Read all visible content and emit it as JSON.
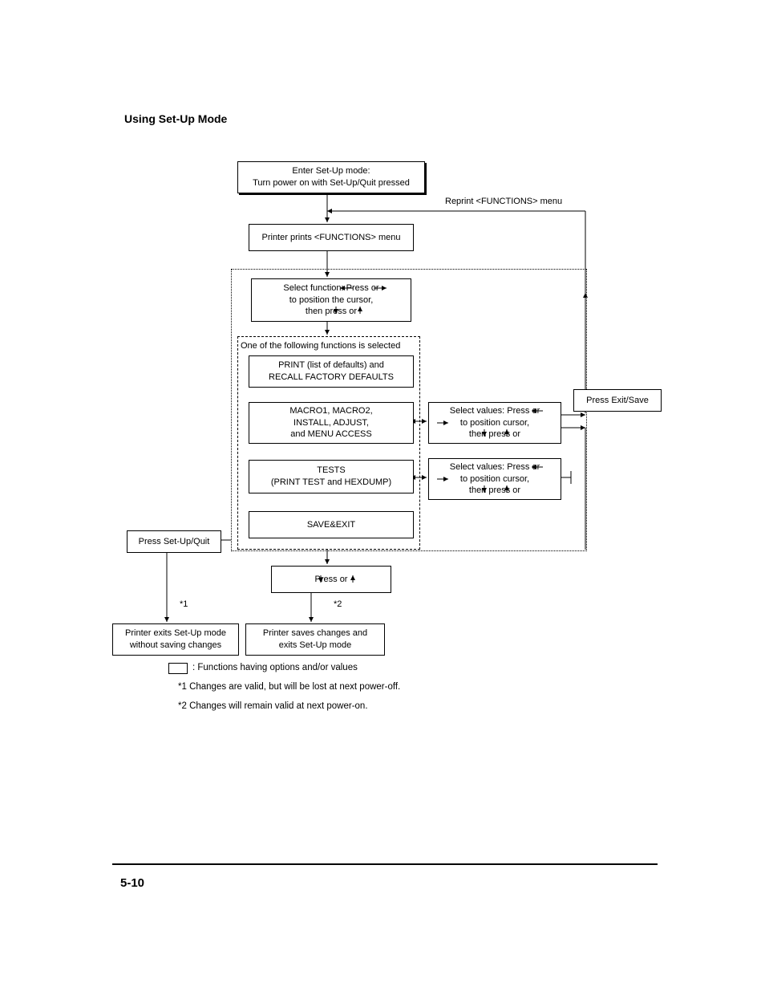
{
  "header": {
    "title": "Using Set-Up Mode"
  },
  "labels": {
    "reprint": "Reprint <FUNCTIONS> menu",
    "exit_save": "Press Exit/Save",
    "setup_quit": "Press Set-Up/Quit",
    "star1": "*1",
    "star2": "*2",
    "one_of": "One of the following functions is selected"
  },
  "boxes": {
    "enter1": "Enter Set-Up mode:",
    "enter2": "Turn power on with Set-Up/Quit pressed",
    "prints": "Printer prints <FUNCTIONS> menu",
    "select1": "Select function:  Press           or",
    "select2": "to position the cursor,",
    "select3": "then press         or",
    "print_defaults1": "PRINT (list of defaults) and",
    "print_defaults2": "RECALL FACTORY DEFAULTS",
    "macro1": "MACRO1, MACRO2,",
    "macro2": "INSTALL, ADJUST,",
    "macro3": "and MENU ACCESS",
    "tests1": "TESTS",
    "tests2": "(PRINT TEST and HEXDUMP)",
    "save_exit": "SAVE&EXIT",
    "sel_val1": "Select values:  Press          or",
    "sel_val2": "       to position cursor,",
    "sel_val3": "then press        or",
    "press_arrow": "Press         or",
    "ex1a": "Printer exits Set-Up mode",
    "ex1b": "without saving changes",
    "ex2a": "Printer saves changes and",
    "ex2b": "exits Set-Up mode"
  },
  "legend": {
    "functions": ": Functions having options and/or values",
    "n1": "*1  Changes are valid, but will be lost at next power-off.",
    "n2": "*2  Changes will remain valid at next power-on."
  },
  "footer": {
    "page": "5-10"
  }
}
